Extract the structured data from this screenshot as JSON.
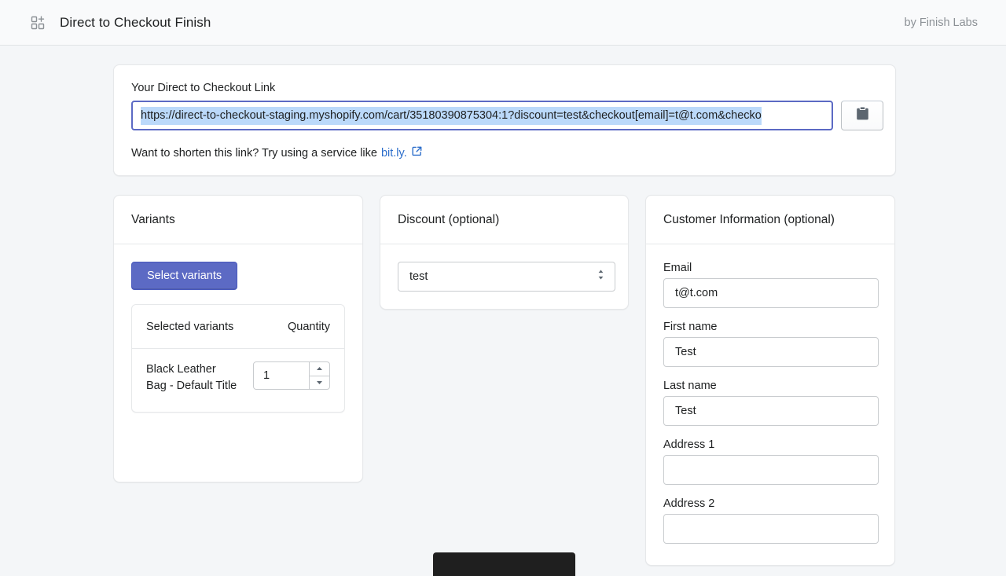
{
  "header": {
    "icon": "apps-grid-plus-icon",
    "title": "Direct to Checkout Finish",
    "byline": "by Finish Labs"
  },
  "link_card": {
    "label": "Your Direct to Checkout Link",
    "url_value": "https://direct-to-checkout-staging.myshopify.com/cart/35180390875304:1?discount=test&checkout[email]=t@t.com&checko",
    "url_placeholder": "",
    "copy_icon": "clipboard-icon",
    "hint_text": "Want to shorten this link? Try using a service like",
    "hint_link": "bit.ly.",
    "external_icon": "external-link-icon"
  },
  "variants_card": {
    "title": "Variants",
    "select_button": "Select variants",
    "table": {
      "columns": [
        "Selected variants",
        "Quantity"
      ],
      "rows": [
        {
          "name": "Black Leather Bag - Default Title",
          "quantity": "1"
        }
      ]
    }
  },
  "discount_card": {
    "title": "Discount (optional)",
    "select_value": "test",
    "select_placeholder": "",
    "options": [
      "test"
    ]
  },
  "customer_card": {
    "title": "Customer Information (optional)",
    "fields": [
      {
        "label": "Email",
        "value": "t@t.com",
        "placeholder": ""
      },
      {
        "label": "First name",
        "value": "Test",
        "placeholder": ""
      },
      {
        "label": "Last name",
        "value": "Test",
        "placeholder": ""
      },
      {
        "label": "Address 1",
        "value": "",
        "placeholder": ""
      },
      {
        "label": "Address 2",
        "value": "",
        "placeholder": ""
      }
    ]
  },
  "toast": {
    "text": ""
  },
  "colors": {
    "page_background": "#f4f6f8",
    "header_background": "#f9fafb",
    "card_background": "#ffffff",
    "primary_button": "#5c6ac4",
    "focus_border": "#5c6ac4",
    "selection_highlight": "#bbd9fa",
    "link": "#2c6ecb",
    "muted_text": "#8c9196",
    "toast_background": "#1f1f1f"
  }
}
